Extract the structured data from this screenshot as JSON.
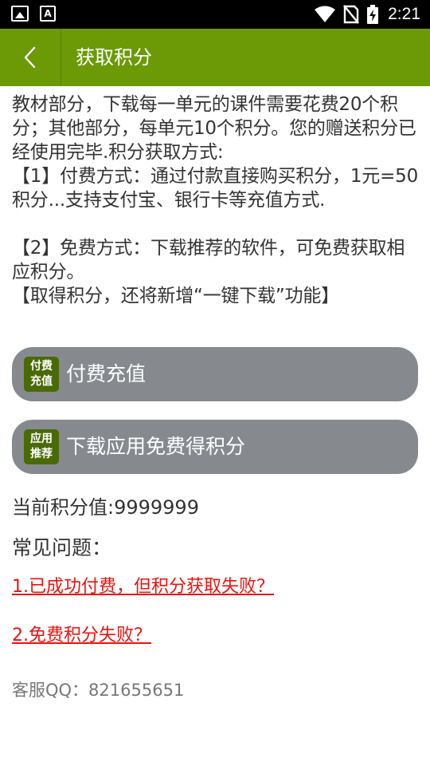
{
  "status_bar": {
    "time": "2:21",
    "icons": [
      "image-icon",
      "text-a-icon",
      "wifi-icon",
      "no-sim-icon",
      "battery-charging-icon"
    ]
  },
  "app_bar": {
    "title": "获取积分",
    "back_icon": "chevron-left-icon",
    "color": "#6b9a06"
  },
  "intro": {
    "paragraph_1": "教材部分，下载每一单元的课件需要花费20个积分；其他部分，每单元10个积分。您的赠送积分已经使用完毕.积分获取方式:",
    "paragraph_2": "【1】付费方式：通过付款直接购买积分，1元=50积分...支持支付宝、银行卡等充值方式.",
    "paragraph_3": "【2】免费方式：下载推荐的软件，可免费获取相应积分。",
    "paragraph_4": "【取得积分，还将新增“一键下载”功能】"
  },
  "buttons": {
    "pay": {
      "badge_line_1": "付费",
      "badge_line_2": "充值",
      "label": "付费充值"
    },
    "free": {
      "badge_line_1": "应用",
      "badge_line_2": "推荐",
      "label": "下载应用免费得积分"
    },
    "color": "#868a8f",
    "badge_color": "#4a6a05"
  },
  "points": {
    "text": "当前积分值:9999999"
  },
  "faq": {
    "title": "常见问题：",
    "items": [
      "1.已成功付费，但积分获取失败？",
      "2.免费积分失败？"
    ],
    "link_color": "#e8140f"
  },
  "service": {
    "text": "客服QQ：821655651"
  }
}
